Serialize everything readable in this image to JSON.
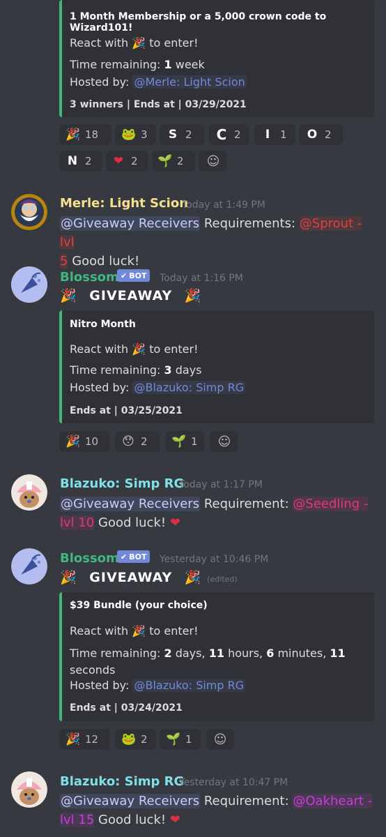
{
  "embed1": {
    "title": "1 Month Membership or a 5,000 crown code to Wizard101!",
    "react_prefix": "React with",
    "react_suffix": "to enter!",
    "time_prefix": "Time remaining:",
    "time_value": "1",
    "time_unit": "week",
    "hosted_prefix": "Hosted by:",
    "host": "@Merle: Light Scion",
    "footer": "3 winners | Ends at | 03/29/2021"
  },
  "reactions1": [
    {
      "icon": "party-popper-icon",
      "glyph": "🎉",
      "count": "18"
    },
    {
      "icon": "frog-icon",
      "glyph": "🐸",
      "count": "3"
    },
    {
      "icon": "letter-s-icon",
      "glyph": "S",
      "count": "2"
    },
    {
      "icon": "letter-c-icon",
      "glyph": "C",
      "count": "2"
    },
    {
      "icon": "letter-i-icon",
      "glyph": "I",
      "count": "1"
    },
    {
      "icon": "letter-o-icon",
      "glyph": "O",
      "count": "2"
    },
    {
      "icon": "letter-n-icon",
      "glyph": "N",
      "count": "2"
    },
    {
      "icon": "heart-icon",
      "glyph": "❤",
      "count": "2"
    },
    {
      "icon": "sprout-icon",
      "glyph": "🌱",
      "count": "2"
    }
  ],
  "msg_merle": {
    "name": "Merle: Light Scion",
    "time": "Today at 1:49 PM",
    "role": "@Giveaway Receivers",
    "text1": "Requirements:",
    "req_role": "@Sprout - lvl",
    "req_role2": "5",
    "text2": "Good luck!"
  },
  "msg_blossom1": {
    "name": "Blossom",
    "badge": "BOT",
    "time": "Today at 1:16 PM",
    "giveaway": "GIVEAWAY"
  },
  "embed2": {
    "title": "Nitro Month",
    "react_prefix": "React with",
    "react_suffix": "to enter!",
    "time_prefix": "Time remaining:",
    "time_value": "3",
    "time_unit": "days",
    "hosted_prefix": "Hosted by:",
    "host": "@Blazuko: Simp RG",
    "footer": "Ends at | 03/25/2021"
  },
  "reactions2": [
    {
      "icon": "party-popper-icon",
      "glyph": "🎉",
      "count": "10"
    },
    {
      "icon": "hushed-face-icon",
      "glyph": "😯",
      "count": "2"
    },
    {
      "icon": "sprout-icon",
      "glyph": "🌱",
      "count": "1"
    }
  ],
  "msg_blazuko1": {
    "name": "Blazuko: Simp RG",
    "time": "Today at 1:17 PM",
    "role": "@Giveaway Receivers",
    "text1": "Requirement:",
    "req_role": "@Seedling -",
    "req_role2": "lvl 10",
    "text2": "Good luck!"
  },
  "msg_blossom2": {
    "name": "Blossom",
    "badge": "BOT",
    "time": "Yesterday at 10:46 PM",
    "giveaway": "GIVEAWAY",
    "edited": "(edited)"
  },
  "embed3": {
    "title": "$39 Bundle (your choice)",
    "react_prefix": "React with",
    "react_suffix": "to enter!",
    "time_prefix": "Time remaining:",
    "t_days": "2",
    "t_days_unit": "days,",
    "t_hours": "11",
    "t_hours_unit": "hours,",
    "t_min": "6",
    "t_min_unit": "minutes,",
    "t_sec": "11",
    "t_sec_unit": "seconds",
    "hosted_prefix": "Hosted by:",
    "host": "@Blazuko: Simp RG",
    "footer": "Ends at | 03/24/2021"
  },
  "reactions3": [
    {
      "icon": "party-popper-icon",
      "glyph": "🎉",
      "count": "12"
    },
    {
      "icon": "pepe-frog-icon",
      "glyph": "🐸",
      "count": "2"
    },
    {
      "icon": "sprout-icon",
      "glyph": "🌱",
      "count": "1"
    }
  ],
  "msg_blazuko2": {
    "name": "Blazuko: Simp RG",
    "time": "Yesterday at 10:47 PM",
    "role": "@Giveaway Receivers",
    "text1": "Requirement:",
    "req_role": "@Oakheart -",
    "req_role2": "lvl 15",
    "text2": "Good luck!"
  },
  "colors": {
    "background": "#36393f",
    "embed_bg": "#2f3136",
    "embed_border": "#43b581",
    "merle_name": "#f5e08c",
    "blossom_name": "#43b581",
    "blazuko_name": "#7fe0e8",
    "bot_badge": "#7289da"
  }
}
